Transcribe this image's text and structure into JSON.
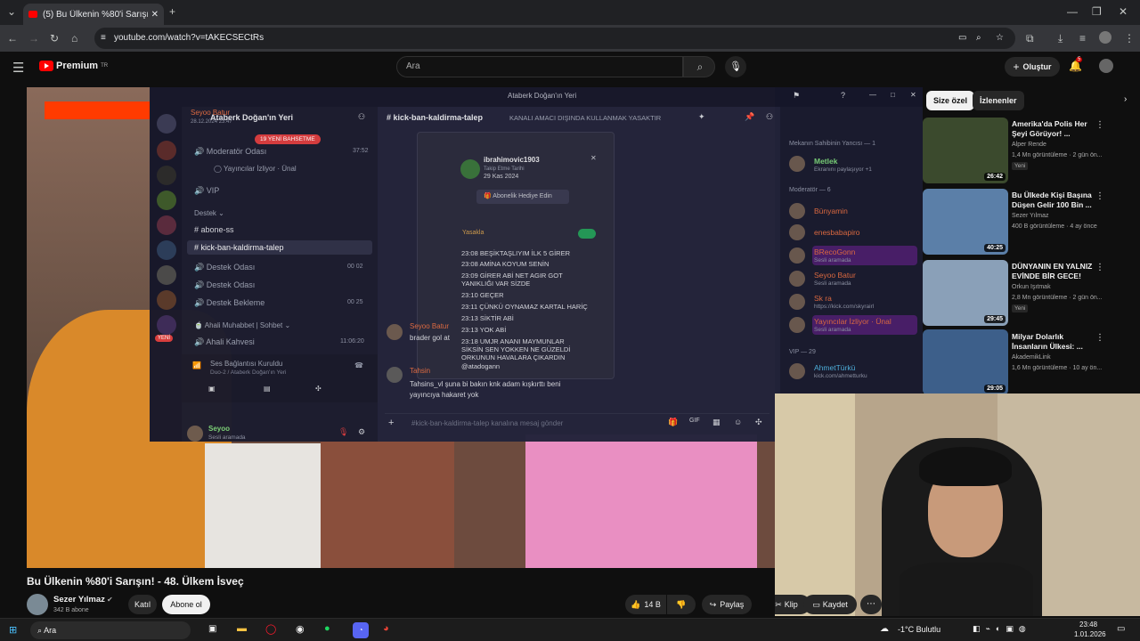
{
  "browser": {
    "tab_title": "(5) Bu Ülkenin %80'i Sarışın! - 4",
    "url": "youtube.com/watch?v=tAKECSECtRs"
  },
  "youtube": {
    "logo": "Premium",
    "region": "TR",
    "search_placeholder": "Ara",
    "create_label": "Oluştur",
    "notif_count": "5"
  },
  "discord": {
    "window_title": "Ataberk Doğan'ın Yeri",
    "server_name": "Ataberk Doğan'ın Yeri",
    "user_top": "Seyoo Batur",
    "user_top_sub": "28.12.2024 23:47",
    "badge": "19 YENİ BAHSETME",
    "channels": [
      {
        "label": "Moderatör Odası",
        "meta": "37:52"
      },
      {
        "label": "Yayıncılar İzliyor · Ünal",
        "meta": ""
      },
      {
        "label": "VIP",
        "meta": ""
      },
      {
        "label": "Destek",
        "meta": ""
      },
      {
        "label": "abone-ss",
        "meta": ""
      },
      {
        "label": "kick-ban-kaldirma-talep",
        "meta": ""
      },
      {
        "label": "Destek Odası",
        "meta": "00 02"
      },
      {
        "label": "Destek Odası",
        "meta": ""
      },
      {
        "label": "Destek Bekleme",
        "meta": "00 25"
      },
      {
        "label": "Ahali Muhabbet | Sohbet",
        "meta": ""
      },
      {
        "label": "Ahali Kahvesi",
        "meta": "11:06:20"
      }
    ],
    "voice_status": "Ses Bağlantısı Kuruldu",
    "voice_sub": "Duo-2 / Ataberk Doğan'ın Yeri",
    "self_name": "Seyoo",
    "self_status": "Sesli aramada",
    "yeni": "YENİ",
    "channel_header": "kick-ban-kaldirma-talep",
    "channel_topic": "KANALI AMACI DIŞINDA KULLANMAK YASAKTIR",
    "popup_user": "ibrahimovic1903",
    "popup_sub": "Takip Etme Tarihi",
    "popup_date": "29 Kas 2024",
    "popup_button": "Abonelik Hediye Edin",
    "popup_toggle_label": "Yasakla",
    "log_lines": [
      "23:08 BEŞİKTAŞLIYIM İLK 5 GİRER",
      "23:08 AMİNA KOYUM SENİN",
      "23:09 GİRER ABİ NET AGIR GOT",
      "YANIKLIĞI VAR SİZDE",
      "23:10 GEÇER",
      "23:11 ÇÜNKÜ OYNAMAZ KARTAL HARİÇ",
      "23:13 SİKTİR ABİ",
      "23:13 YOK ABİ",
      "23:18 UMJR ANANI MAYMUNLAR",
      "SİKSİN SEN YOKKEN NE GÜZELDİ",
      "ORKUNUN HAVALARA ÇIKARDIN",
      "@atadogann"
    ],
    "msg1_user": "Seyoo Batur",
    "msg1_text": "brader gol at",
    "msg2_user": "Tahsin",
    "msg2_text": "Tahsins_vl şuna bi bakın knk adam kışkırttı beni yayıncıya hakaret yok",
    "input_placeholder": "#kick-ban-kaldirma-talep kanalına mesaj gönder",
    "members": [
      {
        "group": "Mekanın Sahibinin Yancısı — 1"
      },
      {
        "name": "Metlek",
        "sub": "Ekranını paylaşıyor +1",
        "color": "#7bd37a"
      },
      {
        "group": "Moderatör — 6"
      },
      {
        "name": "Bünyamin",
        "sub": "",
        "color": "#e06b42"
      },
      {
        "name": "enesbabapiro",
        "sub": "",
        "color": "#e06b42"
      },
      {
        "name": "BRecoGonn",
        "sub": "Sesli aramada",
        "color": "#e06b42"
      },
      {
        "name": "Seyoo Batur",
        "sub": "Sesli aramada",
        "color": "#e06b42"
      },
      {
        "name": "Sk ra",
        "sub": "https://kick.com/skyrairl",
        "color": "#e06b42"
      },
      {
        "name": "Yayıncılar İzliyor · Ünal",
        "sub": "Sesli aramada",
        "color": "#e06b42"
      },
      {
        "group": "VIP — 29"
      },
      {
        "name": "AhmetTürkü",
        "sub": "kick.com/ahmetturku",
        "color": "#4fb3e0"
      }
    ]
  },
  "video": {
    "title": "Bu Ülkenin %80'i Sarışın! - 48. Ülkem İsveç",
    "channel": "Sezer Yılmaz",
    "subs": "342 B abone",
    "join": "Katıl",
    "subscribe": "Abone ol",
    "likes": "14 B",
    "share": "Paylaş",
    "clip": "Klip",
    "save": "Kaydet"
  },
  "chips": {
    "forYou": "Size özel",
    "watched": "İzlenenler"
  },
  "recommendations": [
    {
      "title": "Amerika'da Polis Her Şeyi Görüyor! ...",
      "channel": "Alper Rende",
      "meta": "1,4 Mn görüntüleme · 2 gün ön...",
      "badge": "Yeni",
      "duration": "26:42",
      "color": "#3b4a2d"
    },
    {
      "title": "Bu Ülkede Kişi Başına Düşen Gelir 100 Bin ...",
      "channel": "Sezer Yılmaz",
      "meta": "400 B görüntüleme · 4 ay önce",
      "badge": "",
      "duration": "40:25",
      "color": "#5b7fa8"
    },
    {
      "title": "DÜNYANIN EN YALNIZ EVİNDE BİR GECE!",
      "channel": "Orkun Işıtmak",
      "meta": "2,8 Mn görüntüleme · 2 gün ön...",
      "badge": "Yeni",
      "duration": "29:45",
      "color": "#8aa0b8"
    },
    {
      "title": "Milyar Dolarlık İnsanların Ülkesi: ...",
      "channel": "AkademikLink",
      "meta": "1,6 Mn görüntüleme · 10 ay ön...",
      "badge": "",
      "duration": "29:05",
      "color": "#3d5f8a"
    }
  ],
  "taskbar": {
    "search": "Ara",
    "weather": "-1°C  Bulutlu",
    "time": "23:48",
    "date": "1.01.2026"
  }
}
